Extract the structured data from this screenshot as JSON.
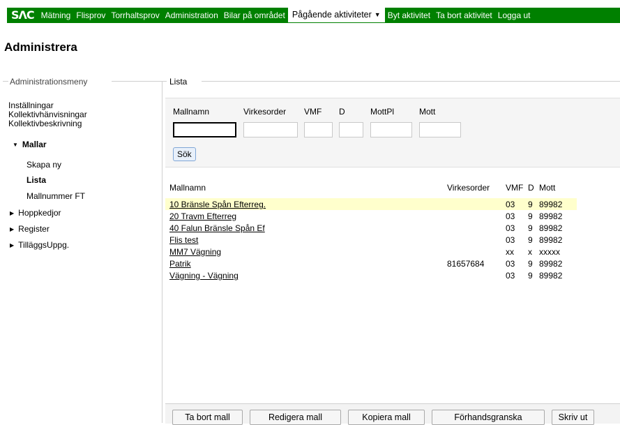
{
  "nav": {
    "logo": "SΛC",
    "items": [
      "Mätning",
      "Flisprov",
      "Torrhaltsprov",
      "Administration",
      "Bilar på området"
    ],
    "active": "Pågående aktiviteter",
    "right_items": [
      "Byt aktivitet",
      "Ta bort aktivitet",
      "Logga ut"
    ]
  },
  "page": {
    "title": "Administrera"
  },
  "sidebar": {
    "header": "Administrationsmeny",
    "links": [
      "Inställningar",
      "Kollektivhänvisningar",
      "Kollektivbeskrivning"
    ],
    "mallar": {
      "label": "Mallar",
      "children": [
        "Skapa ny",
        "Lista",
        "Mallnummer FT"
      ]
    },
    "groups": [
      "Hoppkedjor",
      "Register",
      "TilläggsUppg."
    ]
  },
  "main": {
    "header": "Lista",
    "search": {
      "labels": [
        "Mallnamn",
        "Virkesorder",
        "VMF",
        "D",
        "MottPl",
        "Mott"
      ],
      "values": [
        "",
        "",
        "",
        "",
        "",
        ""
      ],
      "button": "Sök"
    },
    "table": {
      "headers": [
        "Mallnamn",
        "Virkesorder",
        "VMF",
        "D",
        "Mott"
      ],
      "rows": [
        {
          "name": "10 Bränsle Spån Efterreg.",
          "vo": "",
          "vmf": "03",
          "d": "9",
          "mott": "89982"
        },
        {
          "name": "20 Travm Efterreg",
          "vo": "",
          "vmf": "03",
          "d": "9",
          "mott": "89982"
        },
        {
          "name": "40 Falun Bränsle Spån Ef",
          "vo": "",
          "vmf": "03",
          "d": "9",
          "mott": "89982"
        },
        {
          "name": "Flis test",
          "vo": "",
          "vmf": "03",
          "d": "9",
          "mott": "89982"
        },
        {
          "name": "MM7 Vägning",
          "vo": "",
          "vmf": "xx",
          "d": "x",
          "mott": "xxxxx"
        },
        {
          "name": "Patrik",
          "vo": "81657684",
          "vmf": "03",
          "d": "9",
          "mott": "89982"
        },
        {
          "name": "Vägning - Vägning",
          "vo": "",
          "vmf": "03",
          "d": "9",
          "mott": "89982"
        }
      ]
    },
    "buttons": [
      "Ta bort mall",
      "Redigera mall",
      "Kopiera mall",
      "Förhandsgranska",
      "Skriv ut"
    ]
  },
  "colors": {
    "nav_bg": "#008000",
    "highlight_row": "#ffffcc",
    "panel_bg": "#f5f5f5"
  }
}
